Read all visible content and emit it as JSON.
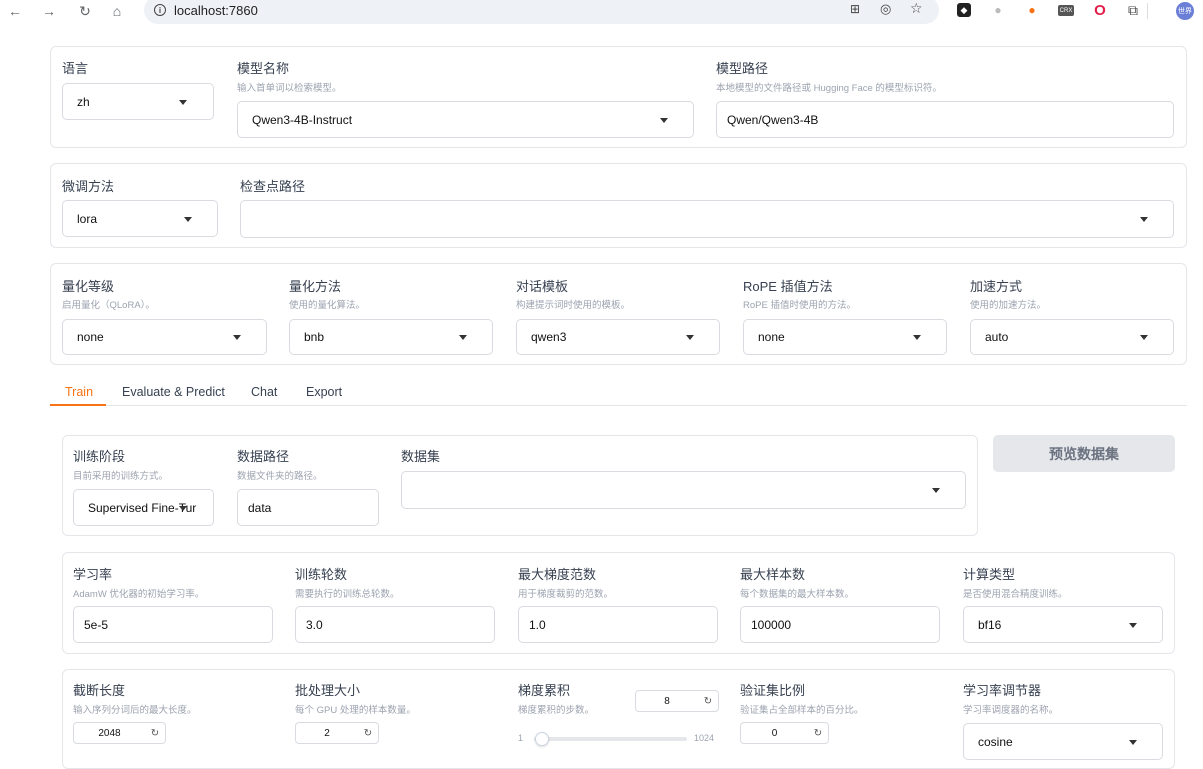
{
  "browser": {
    "url": "localhost:7860",
    "profile_initials": "世界"
  },
  "model_section": {
    "language": {
      "label": "语言",
      "value": "zh"
    },
    "model_name": {
      "label": "模型名称",
      "info": "输入首单词以检索模型。",
      "value": "Qwen3-4B-Instruct"
    },
    "model_path": {
      "label": "模型路径",
      "info": "本地模型的文件路径或 Hugging Face 的模型标识符。",
      "value": "Qwen/Qwen3-4B"
    }
  },
  "finetune_section": {
    "method": {
      "label": "微调方法",
      "value": "lora"
    },
    "checkpoint": {
      "label": "检查点路径",
      "value": ""
    }
  },
  "advanced_section": {
    "quant_bit": {
      "label": "量化等级",
      "info": "启用量化（QLoRA）。",
      "value": "none"
    },
    "quant_method": {
      "label": "量化方法",
      "info": "使用的量化算法。",
      "value": "bnb"
    },
    "template": {
      "label": "对话模板",
      "info": "构建提示词时使用的模板。",
      "value": "qwen3"
    },
    "rope": {
      "label": "RoPE 插值方法",
      "info": "RoPE 插值时使用的方法。",
      "value": "none"
    },
    "booster": {
      "label": "加速方式",
      "info": "使用的加速方法。",
      "value": "auto"
    }
  },
  "tabs": [
    {
      "label": "Train",
      "active": true
    },
    {
      "label": "Evaluate & Predict",
      "active": false
    },
    {
      "label": "Chat",
      "active": false
    },
    {
      "label": "Export",
      "active": false
    }
  ],
  "train": {
    "stage": {
      "label": "训练阶段",
      "info": "目前采用的训练方式。",
      "value": "Supervised Fine-Tur"
    },
    "dataset_dir": {
      "label": "数据路径",
      "info": "数据文件夹的路径。",
      "value": "data"
    },
    "dataset": {
      "label": "数据集",
      "value": ""
    },
    "preview_button": "预览数据集",
    "learning_rate": {
      "label": "学习率",
      "info": "AdamW 优化器的初始学习率。",
      "value": "5e-5"
    },
    "epochs": {
      "label": "训练轮数",
      "info": "需要执行的训练总轮数。",
      "value": "3.0"
    },
    "max_grad_norm": {
      "label": "最大梯度范数",
      "info": "用于梯度裁剪的范数。",
      "value": "1.0"
    },
    "max_samples": {
      "label": "最大样本数",
      "info": "每个数据集的最大样本数。",
      "value": "100000"
    },
    "compute_type": {
      "label": "计算类型",
      "info": "是否使用混合精度训练。",
      "value": "bf16"
    },
    "cutoff_len": {
      "label": "截断长度",
      "info": "输入序列分词后的最大长度。",
      "value": "2048"
    },
    "batch_size": {
      "label": "批处理大小",
      "info": "每个 GPU 处理的样本数量。",
      "value": "2"
    },
    "grad_accum": {
      "label": "梯度累积",
      "info": "梯度累积的步数。",
      "value": "8",
      "min": "1",
      "max": "1024",
      "level": 0.007
    },
    "val_size": {
      "label": "验证集比例",
      "info": "验证集占全部样本的百分比。",
      "value": "0"
    },
    "lr_scheduler": {
      "label": "学习率调节器",
      "info": "学习率调度器的名称。",
      "value": "cosine"
    }
  },
  "colors": {
    "accent": "#f97316",
    "border": "#e4e6ea"
  },
  "icons": [
    "arrow-left-icon",
    "arrow-right-icon",
    "reload-icon",
    "home-icon",
    "info-icon",
    "translate-icon",
    "eye-off-icon",
    "star-icon",
    "extension-icon",
    "reset-icon",
    "dropdown-caret-icon"
  ]
}
